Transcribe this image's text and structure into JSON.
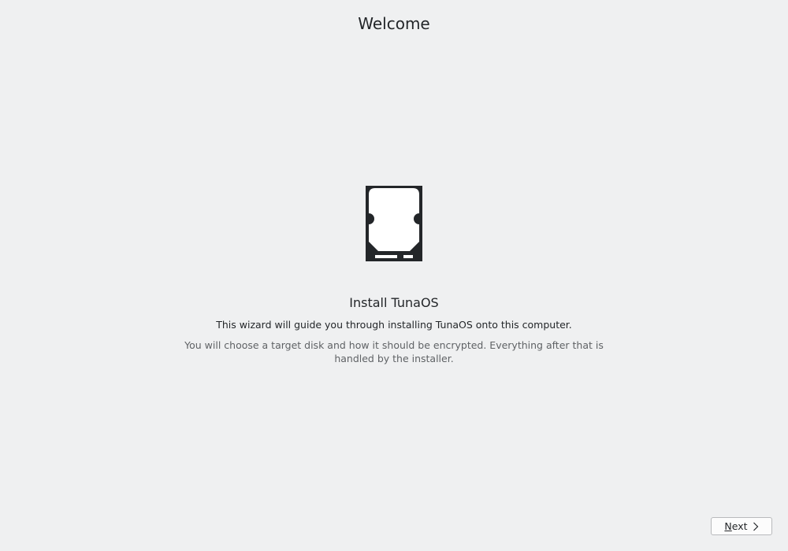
{
  "header": {
    "title": "Welcome"
  },
  "hero": {
    "icon": "hard-drive-icon",
    "headline": "Install TunaOS",
    "subline": "This wizard will guide you through installing TunaOS onto this computer.",
    "detail": "You will choose a target disk and how it should be encrypted. Everything after that is handled by the installer."
  },
  "footer": {
    "next_label_mnemonic": "N",
    "next_label_rest": "ext",
    "next_icon": "chevron-right-icon"
  },
  "colors": {
    "background": "#eff0f1",
    "text": "#232629",
    "muted_text": "#5f6265",
    "icon": "#232629"
  }
}
